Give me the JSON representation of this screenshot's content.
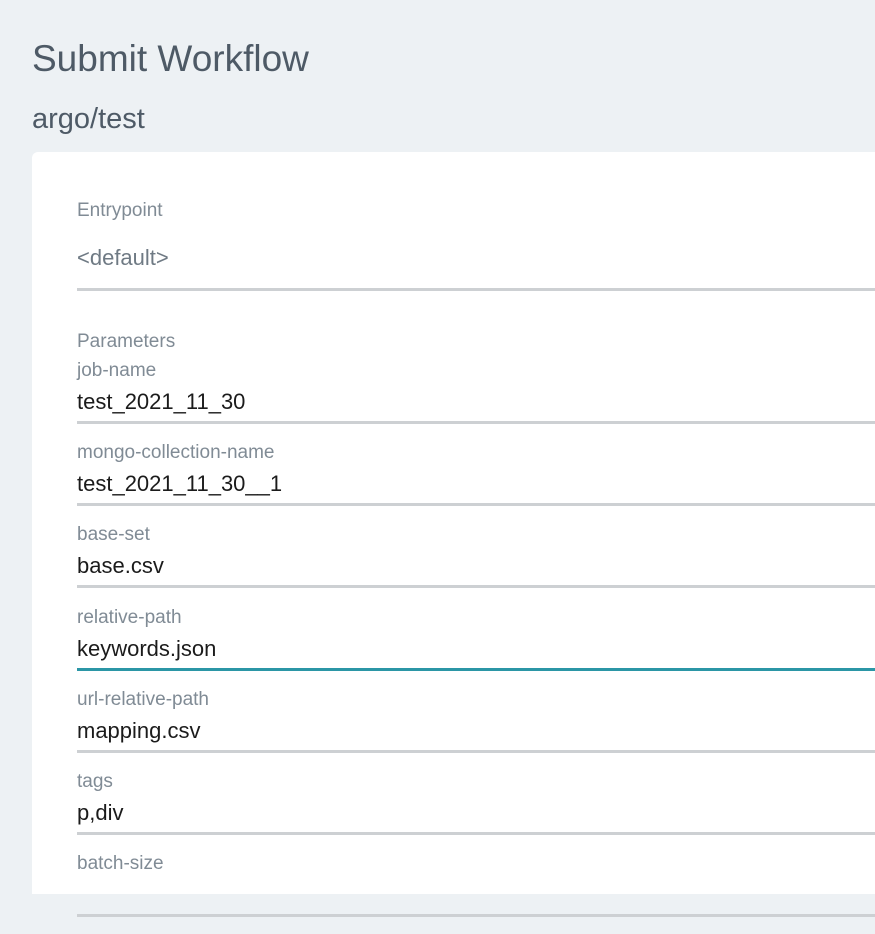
{
  "header": {
    "title": "Submit Workflow",
    "subtitle": "argo/test"
  },
  "form": {
    "entrypoint": {
      "label": "Entrypoint",
      "value": "<default>"
    },
    "parameters_label": "Parameters",
    "parameters": [
      {
        "name": "job-name",
        "value": "test_2021_11_30"
      },
      {
        "name": "mongo-collection-name",
        "value": "test_2021_11_30__1"
      },
      {
        "name": "base-set",
        "value": "base.csv"
      },
      {
        "name": "relative-path",
        "value": "keywords.json",
        "focused": true
      },
      {
        "name": "url-relative-path",
        "value": "mapping.csv"
      },
      {
        "name": "tags",
        "value": "p,div"
      },
      {
        "name": "batch-size",
        "value": ""
      }
    ]
  },
  "colors": {
    "background": "#edf1f4",
    "panel": "#ffffff",
    "heading": "#4e5a66",
    "label": "#808b95",
    "underline": "#cdd0d3",
    "focus_underline": "#2b96a6"
  }
}
